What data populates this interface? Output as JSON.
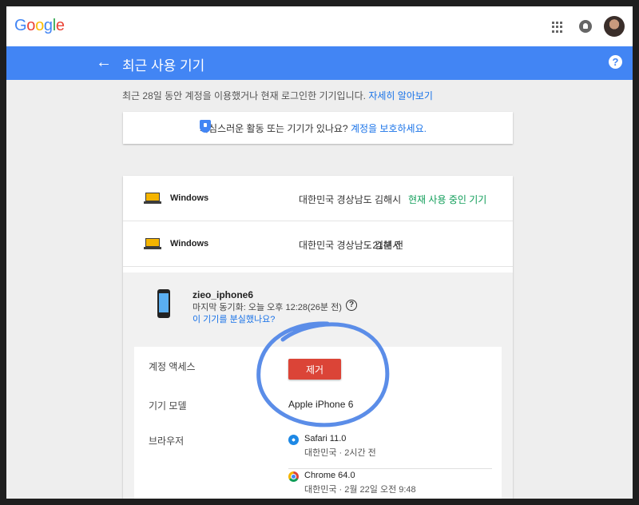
{
  "header": {
    "logo": [
      "G",
      "o",
      "o",
      "g",
      "l",
      "e"
    ],
    "logo_colors": [
      "#4285f4",
      "#ea4335",
      "#fbbc05",
      "#4285f4",
      "#34a853",
      "#ea4335"
    ],
    "icons": [
      "apps-icon",
      "notifications-icon",
      "avatar"
    ]
  },
  "titlebar": {
    "back_icon": "←",
    "title": "최근 사용 기기",
    "help_icon": "?"
  },
  "intro": {
    "text": "최근 28일 동안 계정을 이용했거나 현재 로그인한 기기입니다.",
    "link": "자세히 알아보기"
  },
  "protect": {
    "text": "의심스러운 활동 또는 기기가 있나요?",
    "link": "계정을 보호하세요."
  },
  "devices": [
    {
      "name": "Windows",
      "location": "대한민국 경상남도 김해시",
      "status": "현재 사용 중인 기기"
    },
    {
      "name": "Windows",
      "location": "대한민국 경상남도 김해시",
      "time": "· 21분 전"
    }
  ],
  "phone": {
    "name": "zieo_iphone6",
    "last_sync": "마지막 동기화: 오늘 오후 12:28(26분 전)",
    "help_icon": "?",
    "lost_link": "이 기기를 분실했나요?",
    "account_access_label": "계정 액세스",
    "remove_button": "제거",
    "model_label": "기기 모델",
    "model_value": "Apple iPhone 6",
    "browser_label": "브라우저",
    "browsers": [
      {
        "name": "Safari 11.0",
        "detail": "대한민국 · 2시간 전"
      },
      {
        "name": "Chrome 64.0",
        "detail": "대한민국 · 2월 22일 오전 9:48"
      }
    ]
  },
  "colors": {
    "accent": "#4285f4",
    "remove": "#db4437",
    "active": "#0f9d58",
    "annotation": "#5b8de8"
  }
}
